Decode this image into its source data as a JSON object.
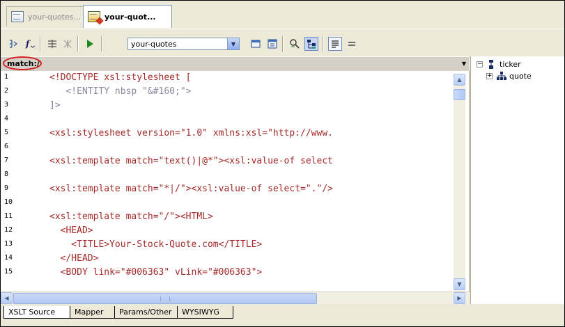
{
  "doc_tabs": [
    {
      "label": "your-quotes..."
    },
    {
      "label": "your-quot..."
    }
  ],
  "toolbar": {
    "select_value": "your-quotes"
  },
  "match": {
    "label": "match:/"
  },
  "editor": {
    "line_numbers": [
      "1",
      "2",
      "3",
      "4",
      "5",
      "6",
      "7",
      "8",
      "9",
      "10",
      "11",
      "12",
      "13",
      "14",
      "15"
    ],
    "lines": [
      "<!DOCTYPE xsl:stylesheet [",
      "   <!ENTITY nbsp \"&#160;\">",
      "]>",
      "",
      "<xsl:stylesheet version=\"1.0\" xmlns:xsl=\"http://www.",
      "",
      "<xsl:template match=\"text()|@*\"><xsl:value-of select",
      "",
      "<xsl:template match=\"*|/\"><xsl:value-of select=\".\"/>",
      "",
      "<xsl:template match=\"/\"><HTML>",
      "  <HEAD>",
      "    <TITLE>Your-Stock-Quote.com</TITLE>",
      "  </HEAD>",
      "  <BODY link=\"#006363\" vLink=\"#006363\">"
    ]
  },
  "tree": {
    "items": [
      {
        "label": "ticker"
      },
      {
        "label": "quote"
      }
    ]
  },
  "bottom_tabs": [
    {
      "label": "XSLT Source"
    },
    {
      "label": "Mapper"
    },
    {
      "label": "Params/Other"
    },
    {
      "label": "WYSIWYG"
    }
  ],
  "colors": {
    "highlight_circle": "#d62020",
    "code_text": "#a52a2a",
    "attr_value": "#1a1aa8"
  }
}
